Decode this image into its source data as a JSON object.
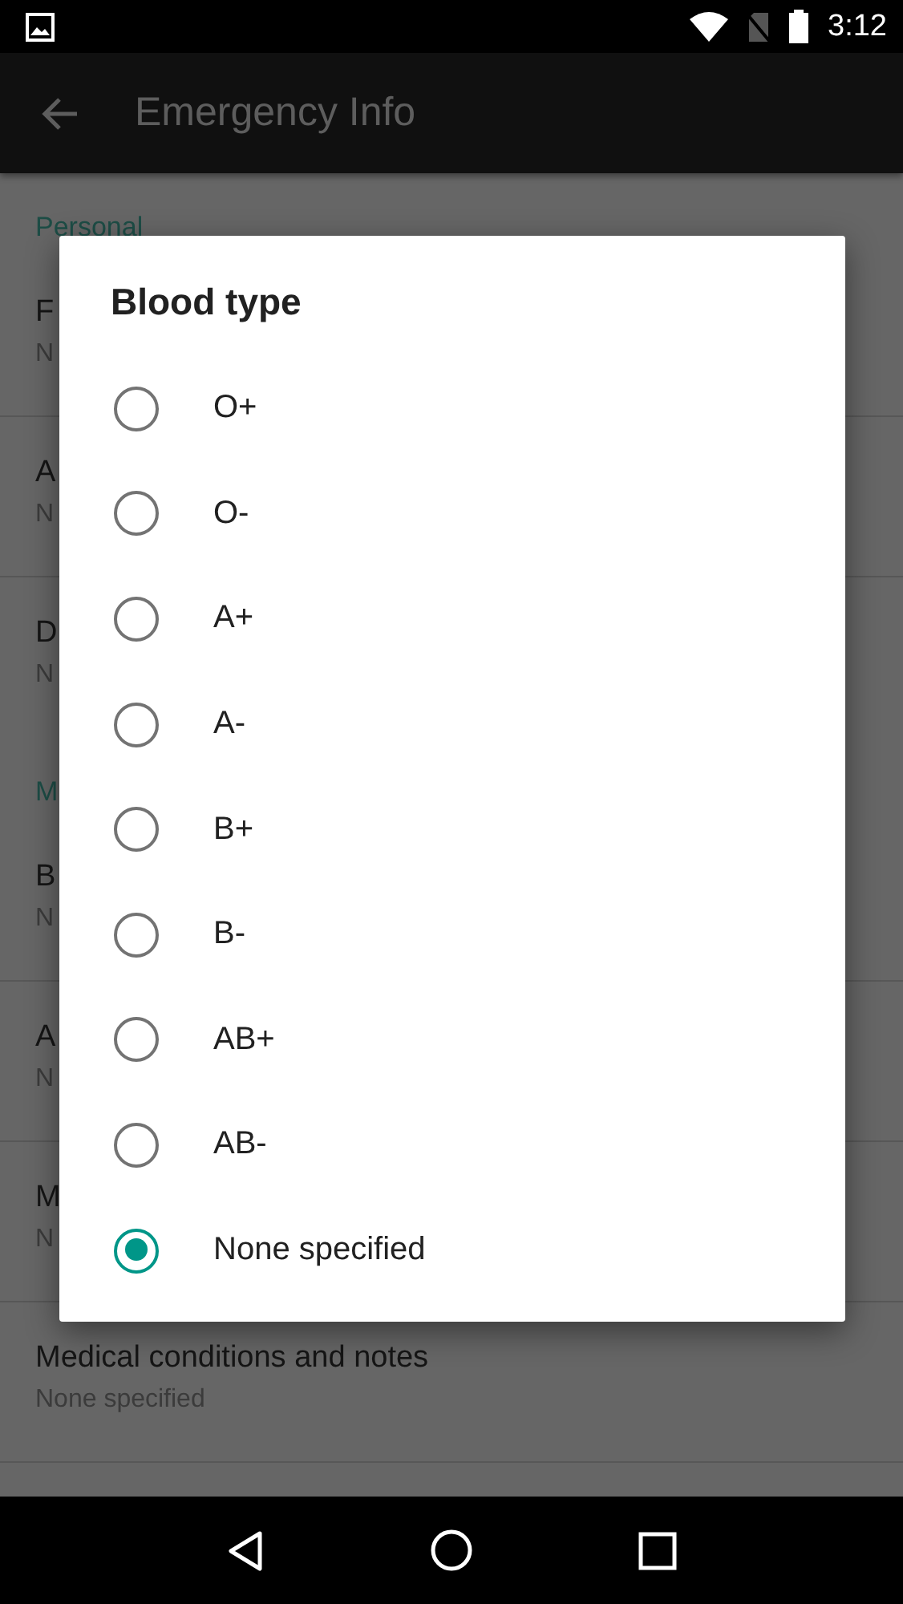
{
  "status_bar": {
    "time": "3:12"
  },
  "app_bar": {
    "title": "Emergency Info"
  },
  "list": [
    {
      "kind": "header",
      "title": "Personal"
    },
    {
      "kind": "item",
      "title": "F",
      "summary": "N"
    },
    {
      "kind": "item",
      "title": "A",
      "summary": "N"
    },
    {
      "kind": "item",
      "title": "D",
      "summary": "N"
    },
    {
      "kind": "header",
      "title": "M"
    },
    {
      "kind": "item",
      "title": "B",
      "summary": "N"
    },
    {
      "kind": "item",
      "title": "A",
      "summary": "N"
    },
    {
      "kind": "item",
      "title": "M",
      "summary": "N"
    },
    {
      "kind": "item",
      "title": "Medical conditions and notes",
      "summary": "None specified"
    }
  ],
  "dialog": {
    "title": "Blood type",
    "options": [
      {
        "label": "O+",
        "selected": false
      },
      {
        "label": "O-",
        "selected": false
      },
      {
        "label": "A+",
        "selected": false
      },
      {
        "label": "A-",
        "selected": false
      },
      {
        "label": "B+",
        "selected": false
      },
      {
        "label": "B-",
        "selected": false
      },
      {
        "label": "AB+",
        "selected": false
      },
      {
        "label": "AB-",
        "selected": false
      },
      {
        "label": "None specified",
        "selected": true
      }
    ]
  }
}
